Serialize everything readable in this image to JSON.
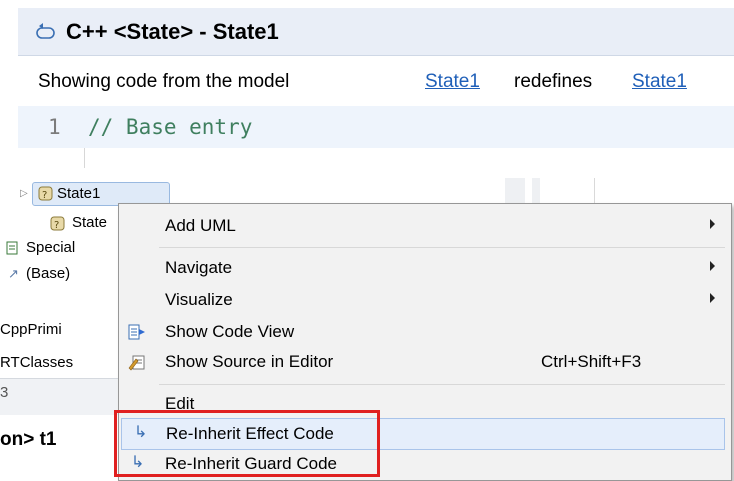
{
  "editor": {
    "title": "C++ <State> - State1",
    "info_text": "Showing code from the model",
    "link_left": "State1",
    "redefines": "redefines",
    "link_right": "State1",
    "line_number": "1",
    "code": "// Base entry"
  },
  "tree": {
    "item1": "State1",
    "item2": "State",
    "item3": "Special",
    "item4": "(Base)",
    "item5": "CppPrimi",
    "item6": "RTClasses",
    "lower_tab_num": "3",
    "lower_title": "on> t1"
  },
  "menu": {
    "add_uml": "Add UML",
    "navigate": "Navigate",
    "visualize": "Visualize",
    "show_code_view": "Show Code View",
    "show_source_in_editor": "Show Source in Editor",
    "show_source_shortcut": "Ctrl+Shift+F3",
    "edit": "Edit",
    "reinherit_effect": "Re-Inherit Effect Code",
    "reinherit_guard": "Re-Inherit Guard Code"
  },
  "colors": {
    "link": "#1f5fb8",
    "highlight_border": "#e02020",
    "hover_background": "#e5eefb"
  }
}
